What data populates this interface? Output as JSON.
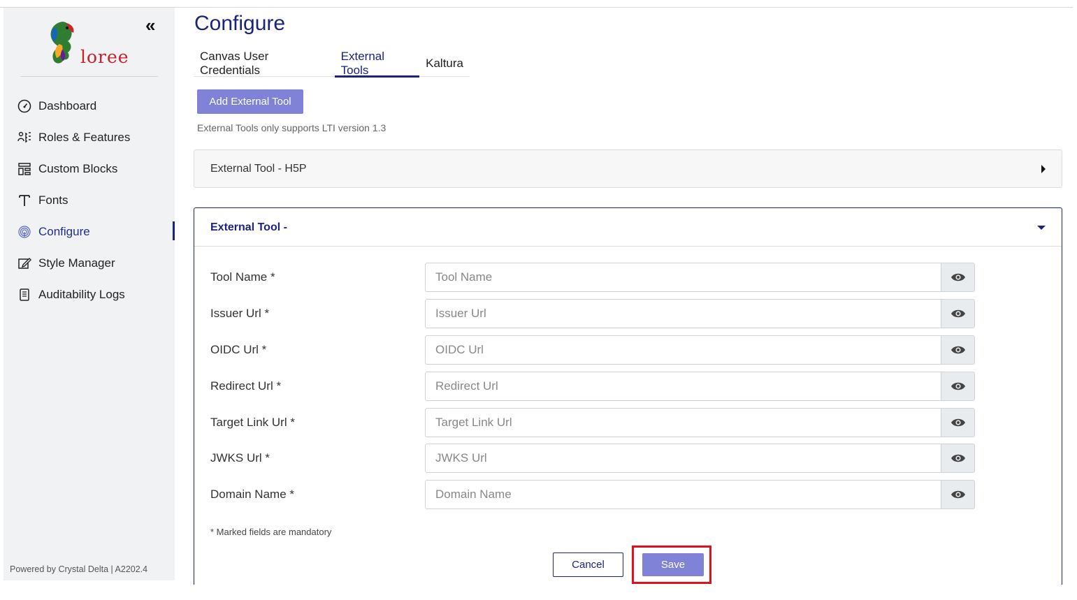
{
  "brand": {
    "logo_text": "loree",
    "powered_by": "Powered by Crystal Delta | A2202.4"
  },
  "sidebar": {
    "collapse_icon": "double-chevron-left-icon",
    "items": [
      {
        "label": "Dashboard",
        "icon": "gauge-icon",
        "active": false
      },
      {
        "label": "Roles & Features",
        "icon": "roles-icon",
        "active": false
      },
      {
        "label": "Custom Blocks",
        "icon": "blocks-icon",
        "active": false
      },
      {
        "label": "Fonts",
        "icon": "font-icon",
        "active": false
      },
      {
        "label": "Configure",
        "icon": "fingerprint-icon",
        "active": true
      },
      {
        "label": "Style Manager",
        "icon": "edit-icon",
        "active": false
      },
      {
        "label": "Auditability Logs",
        "icon": "log-icon",
        "active": false
      }
    ]
  },
  "page": {
    "title": "Configure",
    "tabs": [
      {
        "label": "Canvas User Credentials",
        "active": false
      },
      {
        "label": "External Tools",
        "active": true
      },
      {
        "label": "Kaltura",
        "active": false
      }
    ],
    "add_button": "Add External Tool",
    "note": "External Tools only supports LTI version 1.3"
  },
  "accordions": {
    "collapsed_title": "External Tool - H5P",
    "expanded_title": "External Tool -"
  },
  "form": {
    "fields": [
      {
        "label": "Tool Name *",
        "placeholder": "Tool Name",
        "value": ""
      },
      {
        "label": "Issuer Url *",
        "placeholder": "Issuer Url",
        "value": ""
      },
      {
        "label": "OIDC Url *",
        "placeholder": "OIDC Url",
        "value": ""
      },
      {
        "label": "Redirect Url *",
        "placeholder": "Redirect Url",
        "value": ""
      },
      {
        "label": "Target Link Url *",
        "placeholder": "Target Link Url",
        "value": ""
      },
      {
        "label": "JWKS Url *",
        "placeholder": "JWKS Url",
        "value": ""
      },
      {
        "label": "Domain Name *",
        "placeholder": "Domain Name",
        "value": ""
      }
    ],
    "mandatory_note": "* Marked fields are mandatory",
    "cancel_label": "Cancel",
    "save_label": "Save"
  },
  "colors": {
    "primary": "#1a237e",
    "button_fill": "#7f82d6",
    "highlight": "#e0101d",
    "sidebar_bg": "#f1f2f4"
  }
}
